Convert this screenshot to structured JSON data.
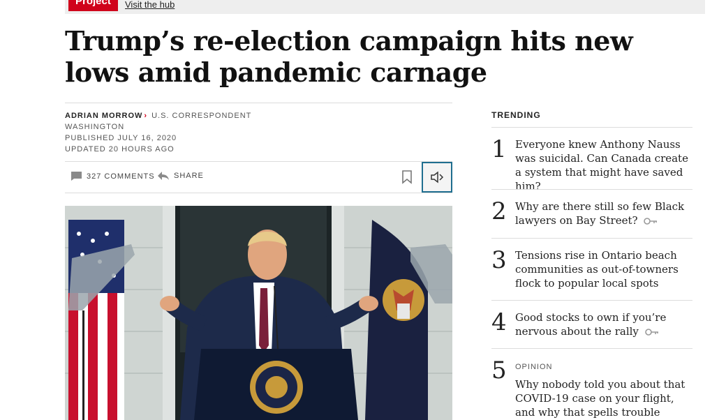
{
  "promo": {
    "tag": "Project",
    "link": "Visit the hub"
  },
  "article": {
    "headline": "Trump’s re-election campaign hits new lows amid pandemic carnage",
    "author": "ADRIAN MORROW",
    "role": "U.S. CORRESPONDENT",
    "location": "WASHINGTON",
    "published": "PUBLISHED JULY 16, 2020",
    "updated": "UPDATED 20 HOURS AGO"
  },
  "toolbar": {
    "comments": "327 COMMENTS",
    "share": "SHARE",
    "bookmark_icon": "bookmark-icon",
    "audio_icon": "speaker-icon",
    "audio_border_color": "#1f6e8f"
  },
  "trending": {
    "title": "TRENDING",
    "items": [
      {
        "num": "1",
        "text": "Everyone knew Anthony Nauss was suicidal. Can Canada create a system that might have saved him?"
      },
      {
        "num": "2",
        "text": "Why are there still so few Black lawyers on Bay Street?",
        "locked": true
      },
      {
        "num": "3",
        "text": "Tensions rise in Ontario beach communities as out-of-towners flock to popular local spots"
      },
      {
        "num": "4",
        "text": "Good stocks to own if you’re nervous about the rally",
        "locked": true
      },
      {
        "num": "5",
        "kicker": "OPINION",
        "text": "Why nobody told you about that COVID-19 case on your flight, and why that spells trouble"
      }
    ]
  },
  "colors": {
    "accent": "#d0021b"
  }
}
